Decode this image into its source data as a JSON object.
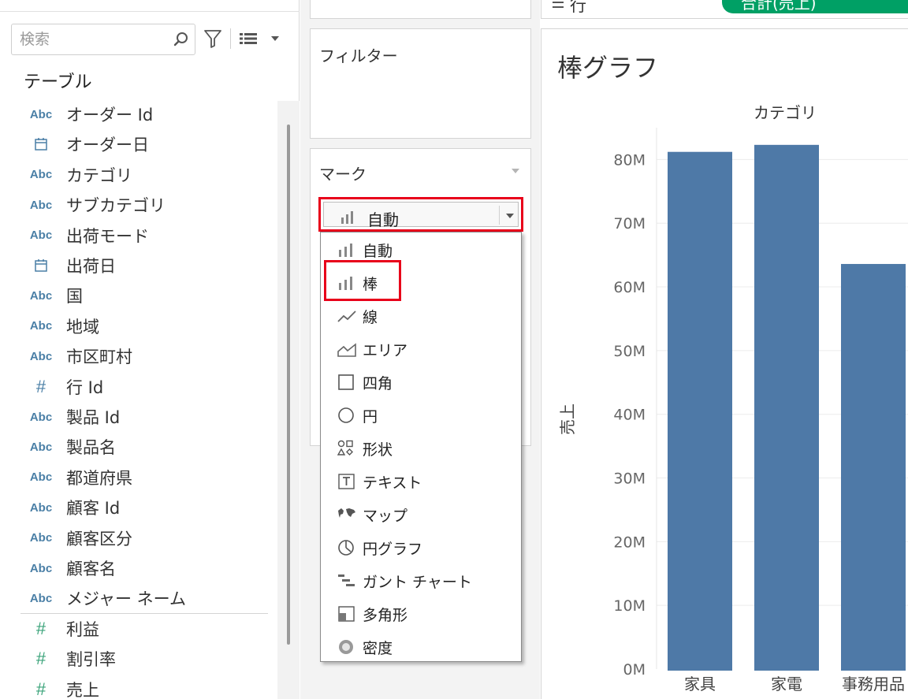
{
  "data_pane": {
    "search_placeholder": "検索",
    "table_heading": "テーブル",
    "fields": [
      {
        "type": "Abc",
        "kind": "dimension",
        "name": "オーダー Id"
      },
      {
        "type": "date",
        "kind": "dimension",
        "name": "オーダー日"
      },
      {
        "type": "Abc",
        "kind": "dimension",
        "name": "カテゴリ"
      },
      {
        "type": "Abc",
        "kind": "dimension",
        "name": "サブカテゴリ"
      },
      {
        "type": "Abc",
        "kind": "dimension",
        "name": "出荷モード"
      },
      {
        "type": "date",
        "kind": "dimension",
        "name": "出荷日"
      },
      {
        "type": "Abc",
        "kind": "dimension",
        "name": "国"
      },
      {
        "type": "Abc",
        "kind": "dimension",
        "name": "地域"
      },
      {
        "type": "Abc",
        "kind": "dimension",
        "name": "市区町村"
      },
      {
        "type": "#",
        "kind": "dimension",
        "name": "行 Id"
      },
      {
        "type": "Abc",
        "kind": "dimension",
        "name": "製品 Id"
      },
      {
        "type": "Abc",
        "kind": "dimension",
        "name": "製品名"
      },
      {
        "type": "Abc",
        "kind": "dimension",
        "name": "都道府県"
      },
      {
        "type": "Abc",
        "kind": "dimension",
        "name": "顧客 Id"
      },
      {
        "type": "Abc",
        "kind": "dimension",
        "name": "顧客区分"
      },
      {
        "type": "Abc",
        "kind": "dimension",
        "name": "顧客名"
      },
      {
        "type": "Abc",
        "kind": "dimension",
        "name": "メジャー ネーム"
      },
      {
        "type": "#",
        "kind": "measure",
        "name": "利益"
      },
      {
        "type": "#",
        "kind": "measure",
        "name": "割引率"
      },
      {
        "type": "#",
        "kind": "measure",
        "name": "売上"
      }
    ]
  },
  "shelves": {
    "filter_label": "フィルター",
    "marks_label": "マーク",
    "rows_label": "行",
    "rows_pill": "合計(売上)",
    "mark_type_selected": "自動",
    "mark_type_options": [
      {
        "icon": "bar-chart-icon",
        "label": "自動"
      },
      {
        "icon": "bar-chart-icon",
        "label": "棒"
      },
      {
        "icon": "line-chart-icon",
        "label": "線"
      },
      {
        "icon": "area-chart-icon",
        "label": "エリア"
      },
      {
        "icon": "square-icon",
        "label": "四角"
      },
      {
        "icon": "circle-icon",
        "label": "円"
      },
      {
        "icon": "shapes-icon",
        "label": "形状"
      },
      {
        "icon": "text-icon",
        "label": "テキスト"
      },
      {
        "icon": "map-icon",
        "label": "マップ"
      },
      {
        "icon": "pie-chart-icon",
        "label": "円グラフ"
      },
      {
        "icon": "gantt-chart-icon",
        "label": "ガント チャート"
      },
      {
        "icon": "polygon-icon",
        "label": "多角形"
      },
      {
        "icon": "density-icon",
        "label": "密度"
      }
    ]
  },
  "colors": {
    "bar": "#4e79a7",
    "highlight": "#e8001a",
    "pill": "#00a065",
    "dimension_icon": "#4a7fa6",
    "measure_icon": "#3aa37a"
  },
  "chart_data": {
    "type": "bar",
    "title": "棒グラフ",
    "header": "カテゴリ",
    "ylabel": "売上",
    "categories": [
      "家具",
      "家電",
      "事務用品"
    ],
    "values": [
      81200000,
      82300000,
      63600000
    ],
    "yticks": [
      "0M",
      "10M",
      "20M",
      "30M",
      "40M",
      "50M",
      "60M",
      "70M",
      "80M"
    ],
    "ylim": [
      0,
      85000000
    ],
    "grid": true
  }
}
